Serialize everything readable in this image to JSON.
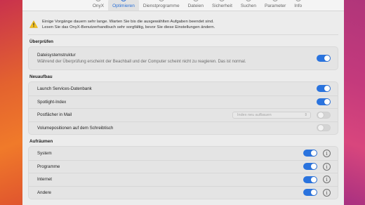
{
  "colors": {
    "accent": "#2a73de",
    "warning": "#f4c21f"
  },
  "toolbar": {
    "tabs": [
      {
        "label": "OnyX",
        "icon": "onyx-icon"
      },
      {
        "label": "Optimieren",
        "icon": "optimize-icon",
        "active": true
      },
      {
        "label": "Dienstprogramme",
        "icon": "utilities-icon"
      },
      {
        "label": "Dateien",
        "icon": "files-icon"
      },
      {
        "label": "Sicherheit",
        "icon": "security-icon"
      },
      {
        "label": "Suchen",
        "icon": "search-icon"
      },
      {
        "label": "Parameter",
        "icon": "parameter-icon"
      },
      {
        "label": "Info",
        "icon": "info-icon"
      }
    ]
  },
  "warning": {
    "icon": "warning-triangle-icon",
    "line1": "Einige Vorgänge dauern sehr lange. Warten Sie bis die ausgewählten Aufgaben beendet sind.",
    "line2": "Lesen Sie das OnyX-Benutzerhandbuch sehr sorgfältig, bevor Sie diese Einstellungen ändern."
  },
  "check": {
    "title": "Überprüfen",
    "row": {
      "label": "Dateisystemstruktur",
      "description": "Während der Überprüfung erscheint der Beachball und der Computer scheint nicht zu reagieren. Das ist normal.",
      "on": true
    }
  },
  "rebuild": {
    "title": "Neuaufbau",
    "rows": [
      {
        "label": "Launch Services-Datenbank",
        "on": true
      },
      {
        "label": "Spotlight-Index",
        "on": true
      },
      {
        "label": "Postfächer in Mail",
        "on": false,
        "select": "Index neu aufbauen"
      },
      {
        "label": "Volumepositionen auf dem Schreibtisch",
        "on": false
      }
    ]
  },
  "cleanup": {
    "title": "Aufräumen",
    "rows": [
      {
        "label": "System",
        "on": true
      },
      {
        "label": "Programme",
        "on": true
      },
      {
        "label": "Internet",
        "on": true
      },
      {
        "label": "Andere",
        "on": true
      }
    ]
  }
}
